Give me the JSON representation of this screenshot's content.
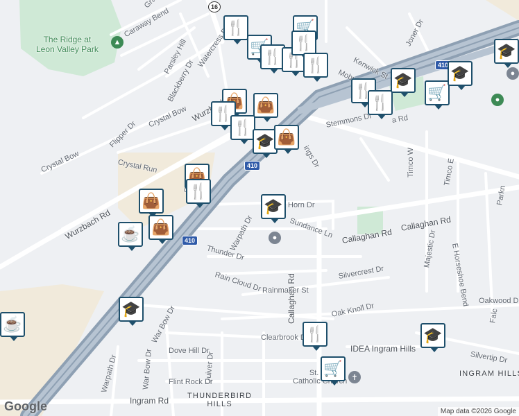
{
  "map": {
    "attribution": "Map data ©2026 Google",
    "logo": "Google",
    "park": "The Ridge at\nLeon Valley Park",
    "areas": [
      "INGRAM HILLS",
      "THUNDERBIRD\nHILLS"
    ],
    "places": [
      "IDEA Ingram Hills",
      "St. Do\nCatholic Church"
    ],
    "shields": {
      "i410": "410",
      "sr16": "16"
    },
    "streets": [
      "Caraway Bend",
      "Parsley Hill",
      "Blackberry Dr",
      "Watercress Dr",
      "Crystal Bow",
      "Flipper Dr",
      "Crystal Run",
      "Wurzbach Rd",
      "Warpath Dr",
      "Thunder Dr",
      "Rain Cloud Dr",
      "Sundance Ln",
      "Callaghan Rd",
      "Silvercrest Dr",
      "Rainmaker St",
      "Oak Knoll Dr",
      "Oakwood Dr",
      "Clearbrook Dr",
      "War Bow Dr",
      "Dove Hill Dr",
      "Quiver Dr",
      "Flint Rock Dr",
      "Ingram Rd",
      "Horn Dr",
      "Stemmons Dr",
      "Kenwick St",
      "Mobud St",
      "Joner Dr",
      "Timco W",
      "Timco E",
      "Majestic Dr",
      "E Horseshoe Bend",
      "Silvertip Dr",
      "Grass",
      "Ingram Rd"
    ],
    "pin_legend": {
      "food": "fork-knife-icon",
      "shop": "shopping-bag-icon",
      "cart": "shopping-cart-icon",
      "school": "graduation-cap-icon",
      "cafe": "coffee-cup-icon"
    }
  }
}
